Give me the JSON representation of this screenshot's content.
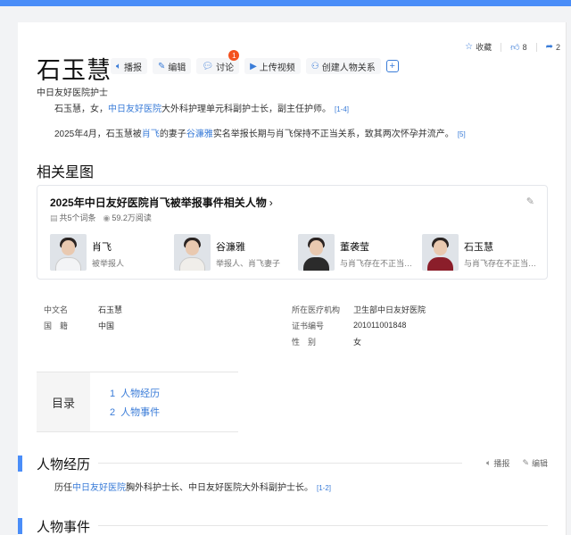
{
  "entry": {
    "title": "石玉慧",
    "subtitle": "中日友好医院护士"
  },
  "toolbar": {
    "report": "播报",
    "edit": "编辑",
    "discuss": "讨论",
    "discuss_badge": "1",
    "upload_video": "上传视频",
    "create_relation": "创建人物关系",
    "add": "+"
  },
  "meta": {
    "favorite": "收藏",
    "likes": "8",
    "shares": "2"
  },
  "intro": {
    "p1_pre": "石玉慧，女，",
    "p1_link": "中日友好医院",
    "p1_post": "大外科护理单元科副护士长，副主任护师。",
    "p1_ref": "[1-4]",
    "p2_pre": "2025年4月，石玉慧被",
    "p2_link1": "肖飞",
    "p2_mid": "的妻子",
    "p2_link2": "谷濂雅",
    "p2_post": "实名举报长期与肖飞保持不正当关系，致其两次怀孕并流产。",
    "p2_ref": "[5]"
  },
  "star_map": {
    "heading": "相关星图",
    "card_title": "2025年中日友好医院肖飞被举报事件相关人物",
    "chevron": "›",
    "entries_count": "共5个词条",
    "reads": "59.2万阅读",
    "people": [
      {
        "name": "肖飞",
        "role": "被举报人",
        "suit": "#f3f4f6"
      },
      {
        "name": "谷濂雅",
        "role": "举报人、肖飞妻子",
        "suit": "#f0eeea"
      },
      {
        "name": "董袭莹",
        "role": "与肖飞存在不正当…",
        "suit": "#2b2b2b"
      },
      {
        "name": "石玉慧",
        "role": "与肖飞存在不正当…",
        "suit": "#8b1e2a"
      }
    ]
  },
  "infobox": {
    "rows": [
      {
        "k1": "中文名",
        "v1": "石玉慧",
        "k2": "所在医疗机构",
        "v2": "卫生部中日友好医院"
      },
      {
        "k1": "国　籍",
        "v1": "中国",
        "k2": "证书编号",
        "v2": "201011001848"
      },
      {
        "k1": "",
        "v1": "",
        "k2": "性　别",
        "v2": "女"
      }
    ]
  },
  "toc": {
    "label": "目录",
    "items": [
      {
        "num": "1",
        "label": "人物经历"
      },
      {
        "num": "2",
        "label": "人物事件"
      }
    ]
  },
  "section1": {
    "title": "人物经历",
    "action_report": "播报",
    "action_edit": "编辑",
    "text_pre": "历任",
    "text_link": "中日友好医院",
    "text_post": "胸外科护士长、中日友好医院大外科副护士长。",
    "ref": "[1-2]"
  },
  "section2": {
    "title": "人物事件"
  },
  "colors": {
    "accent": "#4a8df8",
    "link": "#3a7cd8",
    "badge": "#f4511e"
  }
}
